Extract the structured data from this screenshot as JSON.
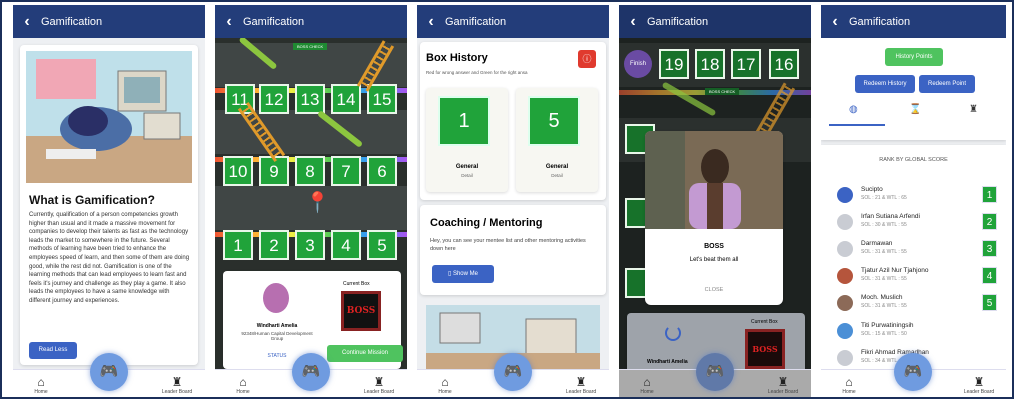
{
  "header_title": "Gamification",
  "nav": {
    "home": "Home",
    "leader": "Leader Board"
  },
  "panel1": {
    "heading": "What is Gamification?",
    "body": "Currently, qualification of a person competencies growth higher than usual and it made a massive movement for companies to develop their talents as fast as the technology leads the market to somewhere in the future. Several methods of learning have been tried to enhance the employees speed of learn, and then some of them are doing good, while the rest did not. Gamification is one of the learning methods that can lead employees to learn fast and feels it's journey and challenge as they play a game. It also leads the employees to have a same knowledge with different journey and experiences.",
    "button": "Read Less"
  },
  "panel2": {
    "boss_check": "BOSS CHECK",
    "top_row": [
      "11",
      "12",
      "13",
      "14",
      "15"
    ],
    "mid_row": [
      "10",
      "9",
      "8",
      "7",
      "6"
    ],
    "bottom_row": [
      "1",
      "2",
      "3",
      "4",
      "5"
    ],
    "user_name": "Windharti Amelia",
    "user_org": "92348/Human Capital Development Group",
    "status": "STATUS",
    "current_box": "Current Box",
    "boss": "BOSS",
    "continue": "Continue Mission"
  },
  "panel3": {
    "title": "Box History",
    "note": "Red for wrong answer and Green for the right ansa",
    "boxes": [
      {
        "num": "1",
        "label": "General",
        "sub": "Detail"
      },
      {
        "num": "5",
        "label": "General",
        "sub": "Detail"
      }
    ],
    "coach_title": "Coaching / Mentoring",
    "coach_text": "Hey, you can see your mentee list and other mentoring activities down here",
    "show_me": "Show Me"
  },
  "panel4": {
    "finish": "Finish",
    "top_row": [
      "19",
      "18",
      "17",
      "16"
    ],
    "boss_check": "BOSS CHECK",
    "modal_title": "BOSS",
    "modal_text": "Let's beat them all",
    "close": "CLOSE",
    "user_name": "Windharti Amelia",
    "current_box": "Current Box",
    "boss": "BOSS"
  },
  "panel5": {
    "history_points": "History Points",
    "redeem_history": "Redeem History",
    "redeem_point": "Redeem Point",
    "rank_title": "RANK BY GLOBAL SCORE",
    "rows": [
      {
        "name": "Sucipto",
        "score": "SOL : 21 & WTL : 65",
        "rank": "1"
      },
      {
        "name": "Irfan Sutiana Arfendi",
        "score": "SOL : 30 & WTL : 55",
        "rank": "2"
      },
      {
        "name": "Darmawan",
        "score": "SOL : 31 & WTL : 55",
        "rank": "3"
      },
      {
        "name": "Tjatur Azil Nur Tjahjono",
        "score": "SOL : 31 & WTL : 55",
        "rank": "4"
      },
      {
        "name": "Moch. Muslich",
        "score": "SOL : 31 & WTL : 55",
        "rank": "5"
      },
      {
        "name": "Titi Purwatiningsih",
        "score": "SOL : 15 & WTL : 50",
        "rank": ""
      },
      {
        "name": "Fikri Ahmad Ramadhan",
        "score": "SOL : 34 & WTL : 45",
        "rank": ""
      }
    ]
  },
  "colors": {
    "header": "#233d7a",
    "tile": "#20a33a",
    "button": "#3b63c4",
    "accent": "#4fc35f"
  }
}
